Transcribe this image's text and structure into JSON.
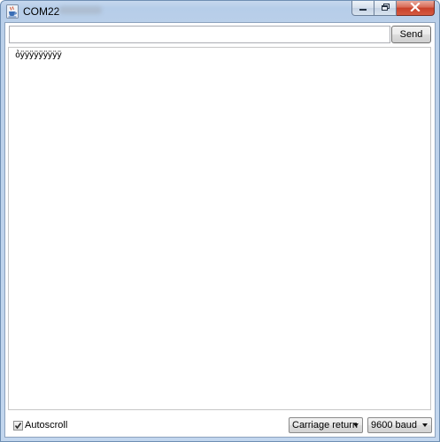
{
  "window": {
    "title": "COM22",
    "icon": "java-cup-icon"
  },
  "controls": {
    "minimize_icon": "minimize-icon",
    "maximize_icon": "maximize-icon",
    "close_icon": "close-icon"
  },
  "toolbar": {
    "input_value": "",
    "input_placeholder": "",
    "send_label": "Send"
  },
  "output": {
    "text": "ỏÿÿÿÿÿÿÿÿÿ"
  },
  "footer": {
    "autoscroll_label": "Autoscroll",
    "autoscroll_checked": true,
    "line_ending_selected": "Carriage return",
    "baud_selected": "9600 baud"
  },
  "colors": {
    "titlebar": "#b9cfe9",
    "close_button": "#c7402a",
    "border": "#6f8fb3"
  }
}
